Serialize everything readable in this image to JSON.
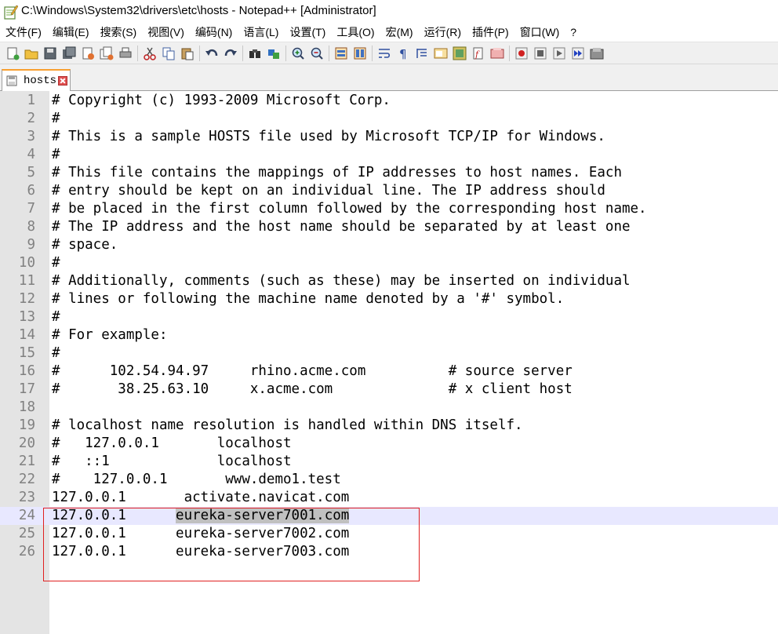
{
  "window": {
    "title": "C:\\Windows\\System32\\drivers\\etc\\hosts - Notepad++ [Administrator]",
    "app_icon": "notepad-plus-plus-icon"
  },
  "menu": [
    "文件(F)",
    "编辑(E)",
    "搜索(S)",
    "视图(V)",
    "编码(N)",
    "语言(L)",
    "设置(T)",
    "工具(O)",
    "宏(M)",
    "运行(R)",
    "插件(P)",
    "窗口(W)",
    "?"
  ],
  "toolbar": {
    "icons": [
      "new-file-icon",
      "open-file-icon",
      "save-icon",
      "save-all-icon",
      "close-icon",
      "close-all-icon",
      "print-icon",
      "|",
      "cut-icon",
      "copy-icon",
      "paste-icon",
      "|",
      "undo-icon",
      "redo-icon",
      "|",
      "find-icon",
      "replace-icon",
      "|",
      "zoom-in-icon",
      "zoom-out-icon",
      "|",
      "sync-vertical-icon",
      "sync-horizontal-icon",
      "|",
      "word-wrap-icon",
      "show-all-chars-icon",
      "indent-guide-icon",
      "doc-map-icon",
      "function-list-icon",
      "folder-workspace-icon",
      "monitor-icon",
      "|",
      "record-macro-icon",
      "stop-macro-icon",
      "play-macro-icon",
      "run-macro-multiple-icon",
      "save-macro-icon"
    ]
  },
  "tab": {
    "label": "hosts",
    "modified": false,
    "accent": "#f8a030"
  },
  "editor": {
    "current_line": 24,
    "lines": [
      "# Copyright (c) 1993-2009 Microsoft Corp.",
      "#",
      "# This is a sample HOSTS file used by Microsoft TCP/IP for Windows.",
      "#",
      "# This file contains the mappings of IP addresses to host names. Each",
      "# entry should be kept on an individual line. The IP address should",
      "# be placed in the first column followed by the corresponding host name.",
      "# The IP address and the host name should be separated by at least one",
      "# space.",
      "#",
      "# Additionally, comments (such as these) may be inserted on individual",
      "# lines or following the machine name denoted by a '#' symbol.",
      "#",
      "# For example:",
      "#",
      "#      102.54.94.97     rhino.acme.com          # source server",
      "#       38.25.63.10     x.acme.com              # x client host",
      "",
      "# localhost name resolution is handled within DNS itself.",
      "#   127.0.0.1       localhost",
      "#   ::1             localhost",
      "#    127.0.0.1       www.demo1.test",
      "127.0.0.1       activate.navicat.com",
      "127.0.0.1      eureka-server7001.com",
      "127.0.0.1      eureka-server7002.com",
      "127.0.0.1      eureka-server7003.com"
    ],
    "selected_text": "eureka-server7001.com"
  },
  "colors": {
    "gutter": "#e4e4e4",
    "line_number": "#808080",
    "current_line": "#e8e8ff",
    "selection": "#c0c0c0",
    "annotation_box": "#e02020"
  }
}
